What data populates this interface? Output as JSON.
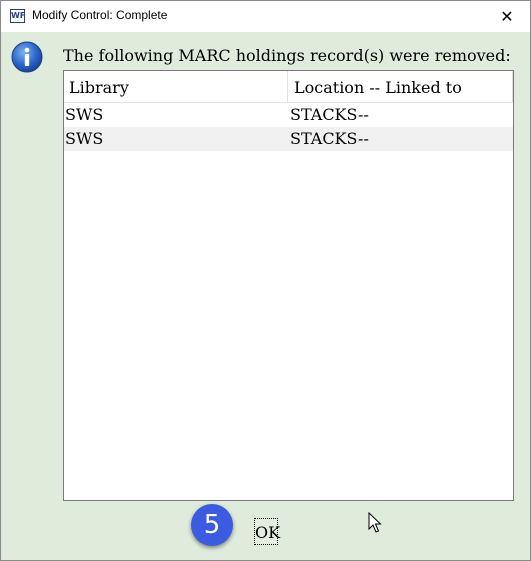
{
  "window": {
    "title": "Modify Control: Complete",
    "app_icon_text": "WF",
    "close_symbol": "✕"
  },
  "dialog": {
    "message": "The following MARC holdings record(s) were removed:",
    "icon": "info-icon",
    "table": {
      "columns": [
        "Library",
        "Location -- Linked to"
      ],
      "rows": [
        {
          "library": "SWS",
          "location": "STACKS--"
        },
        {
          "library": "SWS",
          "location": "STACKS--"
        }
      ]
    },
    "ok_label": "OK",
    "step_badge": "5"
  },
  "colors": {
    "background": "#dfecdc",
    "badge": "#3b5be0",
    "info_icon": "#2a66c9"
  }
}
